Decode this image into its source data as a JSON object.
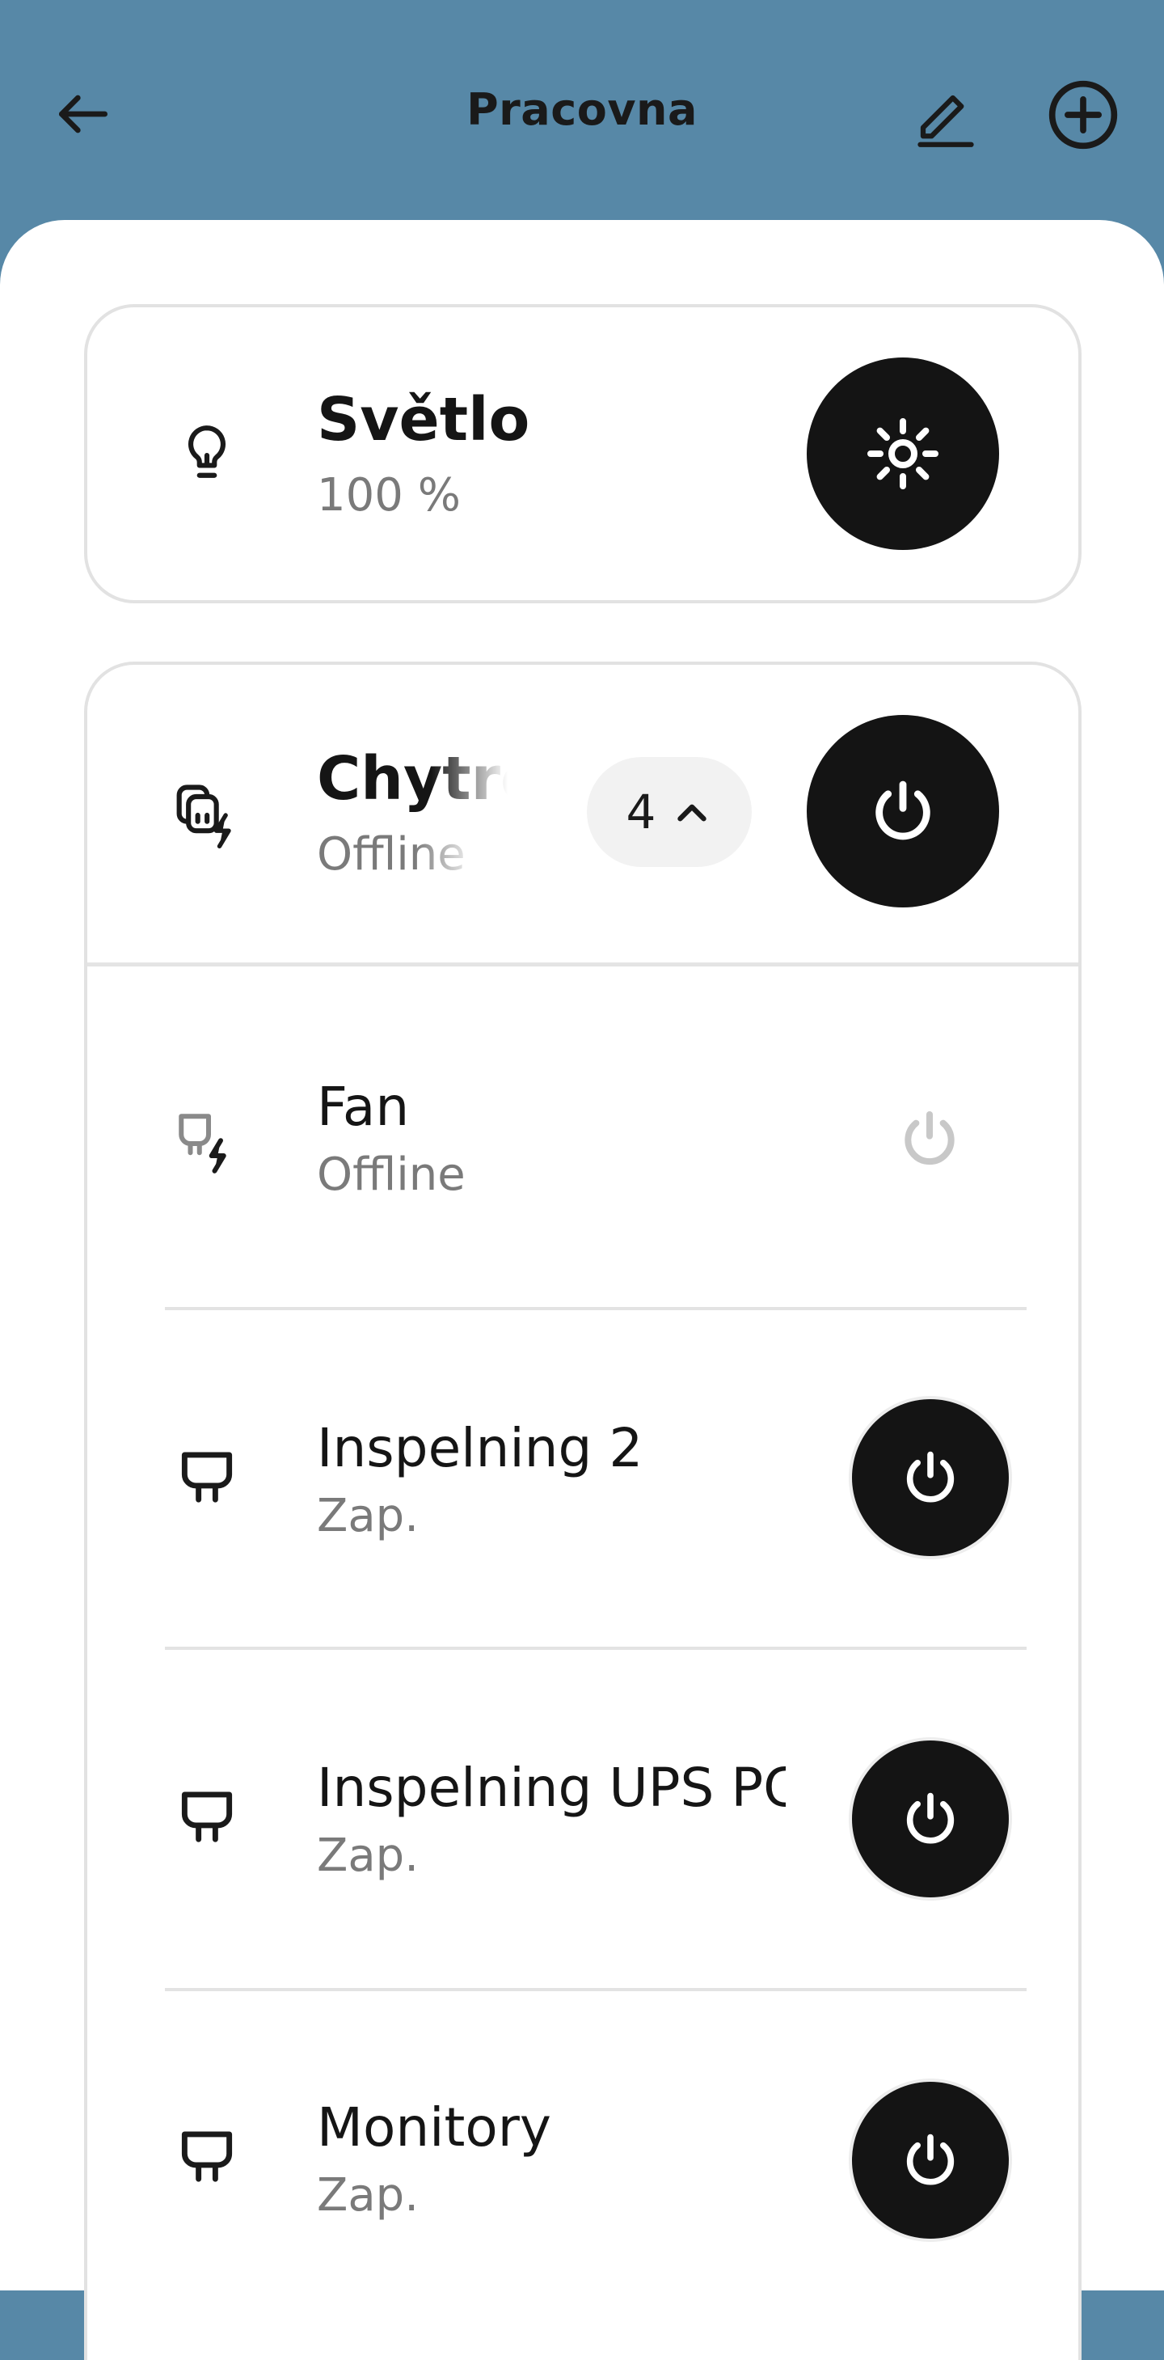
{
  "header": {
    "title": "Pracovna",
    "back_icon": "arrow-left-icon",
    "edit_icon": "pencil-icon",
    "add_icon": "plus-circle-icon"
  },
  "light_card": {
    "name": "Světlo",
    "value": "100 %",
    "icon": "bulb-icon",
    "action_icon": "brightness-icon"
  },
  "group_card": {
    "name": "Chytré",
    "status": "Offline",
    "count": "4",
    "icon": "smart-plug-group-icon",
    "action_icon": "power-icon"
  },
  "devices": [
    {
      "name": "Fan",
      "status": "Offline",
      "icon": "plug-offline-icon",
      "power_active": false
    },
    {
      "name": "Inspelning 2",
      "status": "Zap.",
      "icon": "plug-icon",
      "power_active": true
    },
    {
      "name": "Inspelning UPS PC",
      "status": "Zap.",
      "icon": "plug-icon",
      "power_active": true
    },
    {
      "name": "Monitory",
      "status": "Zap.",
      "icon": "plug-icon",
      "power_active": true
    }
  ],
  "colors": {
    "header_bg": "#5788a7",
    "button_dark": "#141414",
    "text_secondary": "#7a7a7a",
    "border": "#e2e2e2"
  }
}
